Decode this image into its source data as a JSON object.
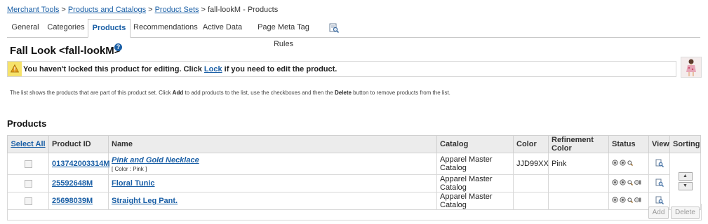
{
  "breadcrumb": {
    "merchant_tools": "Merchant Tools",
    "products_catalogs": "Products and Catalogs",
    "product_sets": "Product Sets",
    "current": "fall-lookM - Products",
    "sep": ">"
  },
  "tabs": [
    {
      "label": "General"
    },
    {
      "label": "Categories"
    },
    {
      "label": "Products"
    },
    {
      "label": "Recommendations"
    },
    {
      "label": "Active Data"
    },
    {
      "label": "Page Meta Tag Rules"
    }
  ],
  "page": {
    "title": "Fall Look <fall-lookM>",
    "help_glyph": "?"
  },
  "lock_message": {
    "before": "You haven't locked this product for editing. Click ",
    "link": "Lock",
    "after": " if you need to edit the product."
  },
  "info": {
    "part1": "The list shows the products that are part of this product set. Click ",
    "add": "Add",
    "part2": " to add products to the list, use the checkboxes and then the ",
    "delete": "Delete",
    "part3": " button to remove products from the list."
  },
  "section_title": "Products",
  "table": {
    "headers": {
      "select_all": "Select All",
      "product_id": "Product ID",
      "name": "Name",
      "catalog": "Catalog",
      "color": "Color",
      "refinement_color": "Refinement Color",
      "status": "Status",
      "view": "View",
      "sorting": "Sorting"
    },
    "rows": [
      {
        "product_id": "013742003314M",
        "name": "Pink and Gold Necklace",
        "variant": "[ Color :  Pink ]",
        "catalog": "Apparel Master Catalog",
        "color": "JJD99XX",
        "refinement_color": "Pink"
      },
      {
        "product_id": "25592648M",
        "name": "Floral Tunic",
        "catalog": "Apparel Master Catalog",
        "color": "",
        "refinement_color": ""
      },
      {
        "product_id": "25698039M",
        "name": "Straight Leg Pant.",
        "catalog": "Apparel Master Catalog",
        "color": "",
        "refinement_color": ""
      }
    ]
  },
  "buttons": {
    "add": "Add",
    "delete": "Delete"
  },
  "colors": {
    "link": "#1a5fa6",
    "warning": "#f6e26a",
    "header_bg": "#ececec"
  },
  "icons": {
    "tab_extra": "search-page-icon",
    "warning": "warning-icon",
    "help": "help-icon",
    "status": [
      "online-icon",
      "searchable-icon",
      "search-icon",
      "sitemap-icon"
    ],
    "view": "view-magnifier-icon",
    "sort_up": "sort-up-icon",
    "sort_down": "sort-down-icon"
  }
}
